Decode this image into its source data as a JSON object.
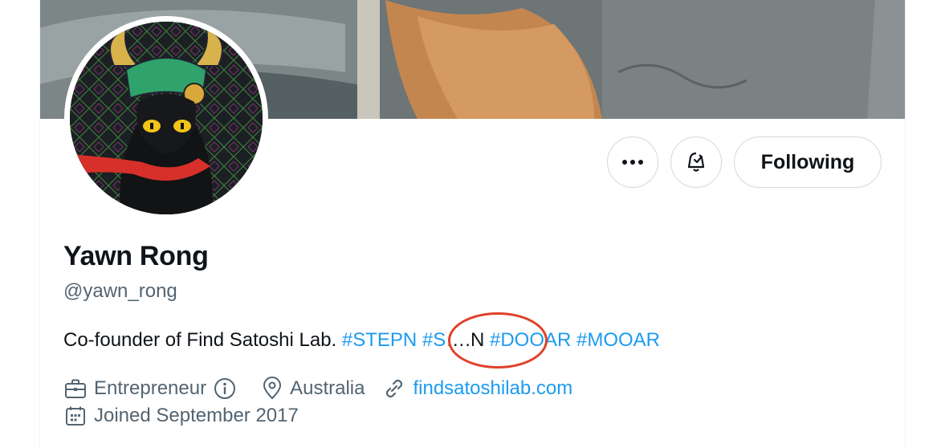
{
  "profile": {
    "name": "Yawn Rong",
    "handle": "@yawn_rong",
    "bio": {
      "text": "Co-founder of Find Satoshi Lab.",
      "tags": [
        "#STEPN",
        "#S",
        "#DOOAR",
        "#MOOAR"
      ],
      "ellipsis": "….N"
    },
    "category": "Entrepreneur",
    "location": "Australia",
    "website": "findsatoshilab.com",
    "joined": "Joined September 2017"
  },
  "actions": {
    "more_icon": "more-icon",
    "notify_icon": "bell-icon",
    "follow_label": "Following"
  },
  "colors": {
    "accent": "#1d9bf0",
    "annotation": "#e0402a",
    "muted": "#536471"
  }
}
